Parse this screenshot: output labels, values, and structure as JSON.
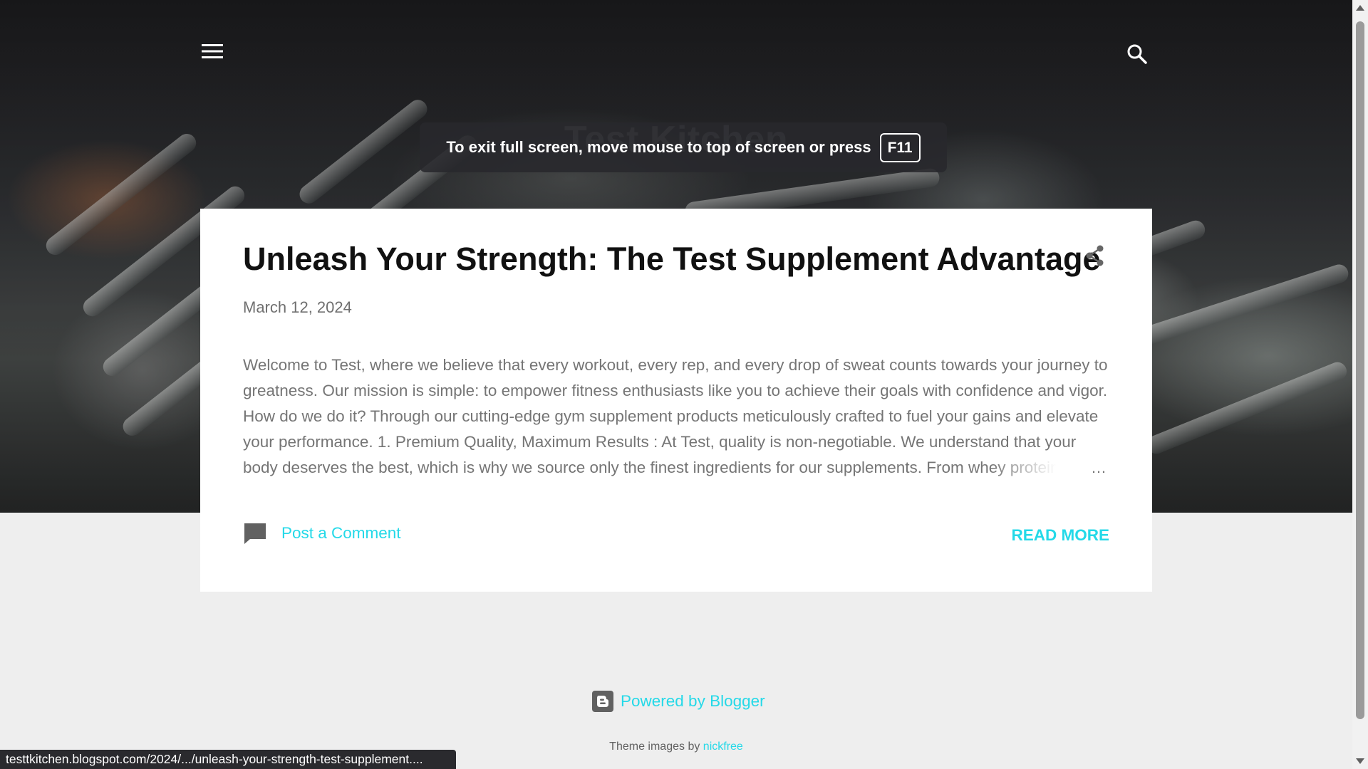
{
  "blog": {
    "title": "Test Kitchen"
  },
  "fullscreen_notice": {
    "text": "To exit full screen, move mouse to top of screen or press",
    "key": "F11"
  },
  "post": {
    "title": "Unleash Your Strength: The Test Supplement Advantage",
    "date": "March 12, 2024",
    "snippet": "Welcome to Test, where we believe that every workout, every rep, and every drop of sweat counts towards your journey to greatness. Our mission is simple: to empower fitness enthusiasts like you to achieve their goals with confidence and vigor. How do we do it? Through our cutting-edge gym supplement products meticulously crafted to fuel your gains and elevate your performance. 1. Premium Quality, Maximum Results : At Test, quality is non-negotiable. We understand that your body deserves the best, which is why we source only the finest ingredients for our supplements. From whey protein",
    "ellipsis": "…",
    "comment_label": "Post a Comment",
    "read_more_label": "READ MORE"
  },
  "footer": {
    "powered_by": "Powered by Blogger",
    "theme_prefix": "Theme images by",
    "theme_author": "nickfree"
  },
  "status_bar": {
    "url": "testtkitchen.blogspot.com/2024/.../unleash-your-strength-test-supplement...."
  },
  "icons": {
    "menu": "menu-icon",
    "search": "search-icon",
    "share": "share-icon",
    "comment": "comment-icon",
    "blogger": "blogger-logo-icon"
  },
  "colors": {
    "accent": "#24d9e8",
    "page_background": "#eeeeee",
    "card_background": "#ffffff"
  }
}
